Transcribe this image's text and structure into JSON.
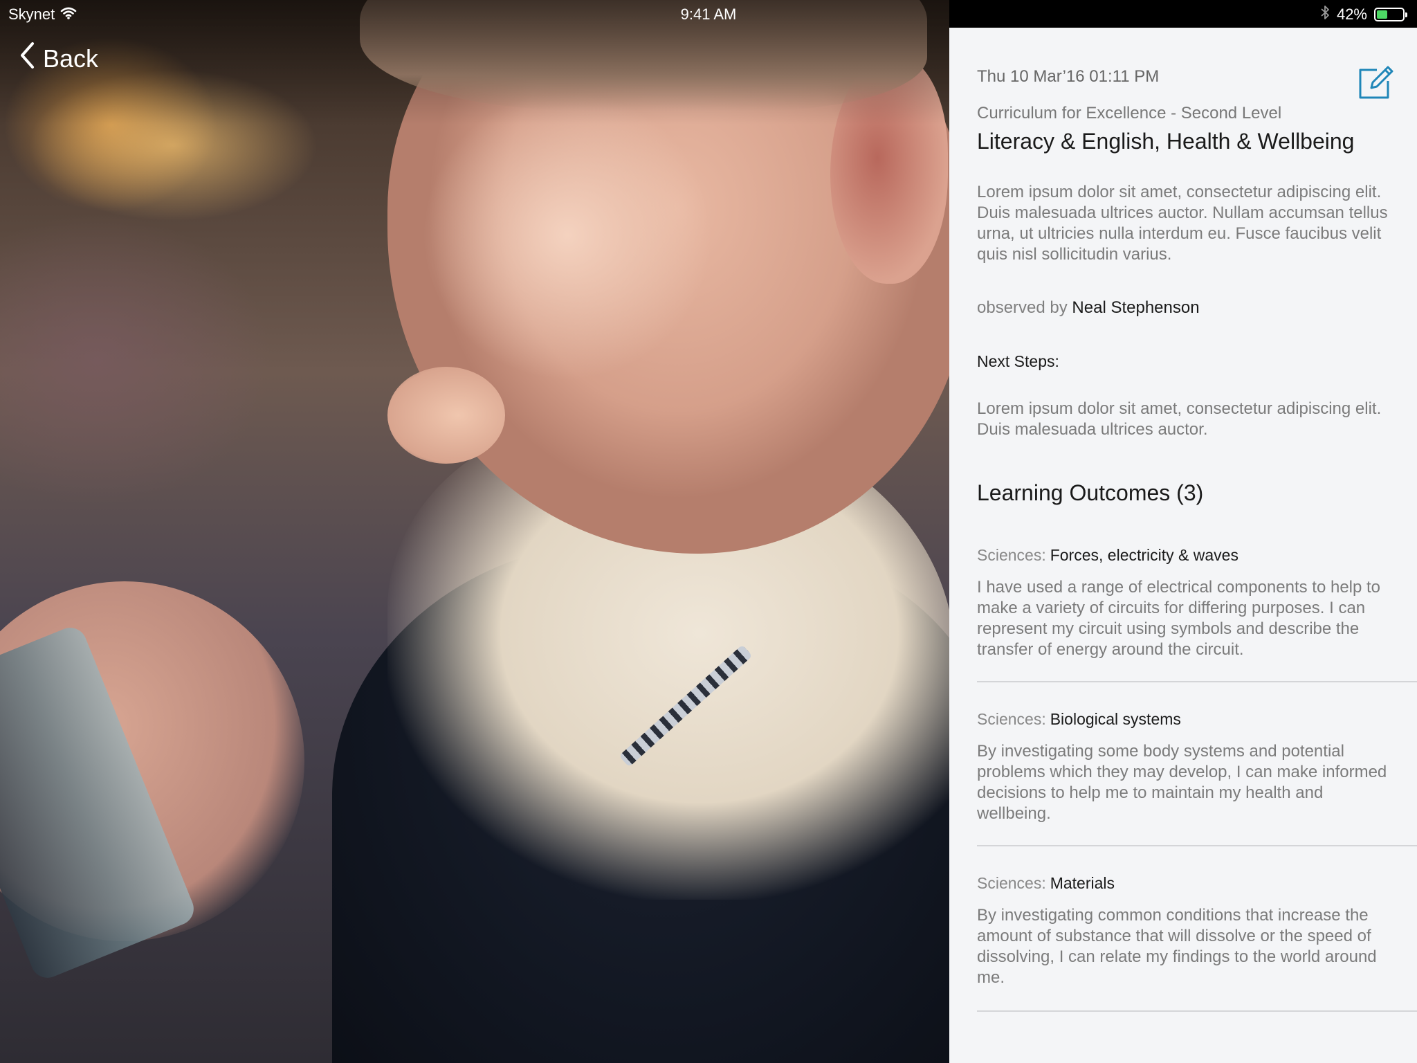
{
  "status_bar": {
    "carrier": "Skynet",
    "time": "9:41 AM",
    "battery_percent_label": "42%",
    "battery_level": 0.42,
    "icons": [
      "wifi-icon",
      "bluetooth-icon",
      "battery-icon"
    ]
  },
  "nav": {
    "back_label": "Back"
  },
  "photo": {
    "description_icon": "photo-boy-with-tablet"
  },
  "observation": {
    "datetime": "Thu 10 Mar’16 01:11 PM",
    "curriculum": "Curriculum for Excellence - Second Level",
    "subject": "Literacy & English, Health & Wellbeing",
    "description": "Lorem ipsum dolor sit amet, consectetur adipiscing elit. Duis malesuada ultrices auctor. Nullam accumsan tellus urna, ut ultricies nulla interdum eu. Fusce faucibus velit quis nisl sollicitudin varius.",
    "observed_prefix": "observed by",
    "observer": "Neal Stephenson",
    "next_steps_label": "Next Steps:",
    "next_steps_text": "Lorem ipsum dolor sit amet, consectetur adipiscing elit. Duis malesuada ultrices auctor."
  },
  "learning_outcomes": {
    "title": "Learning Outcomes (3)",
    "items": [
      {
        "area": "Sciences:",
        "topic": "Forces, electricity & waves",
        "text": "I have used a range of electrical components to help to make a variety of circuits for differing purposes. I can represent my circuit using symbols and describe the transfer of energy around the circuit."
      },
      {
        "area": "Sciences:",
        "topic": "Biological systems",
        "text": "By investigating some body systems and potential problems which they may develop, I can make informed decisions to help me to maintain my health and wellbeing."
      },
      {
        "area": "Sciences:",
        "topic": "Materials",
        "text": "By investigating common conditions that increase the amount of substance that will dissolve or the speed of dissolving, I can relate my findings to the world around me."
      }
    ]
  },
  "colors": {
    "accent": "#1f86b8",
    "panel_bg": "#f4f5f7",
    "battery_green": "#4cd964"
  }
}
